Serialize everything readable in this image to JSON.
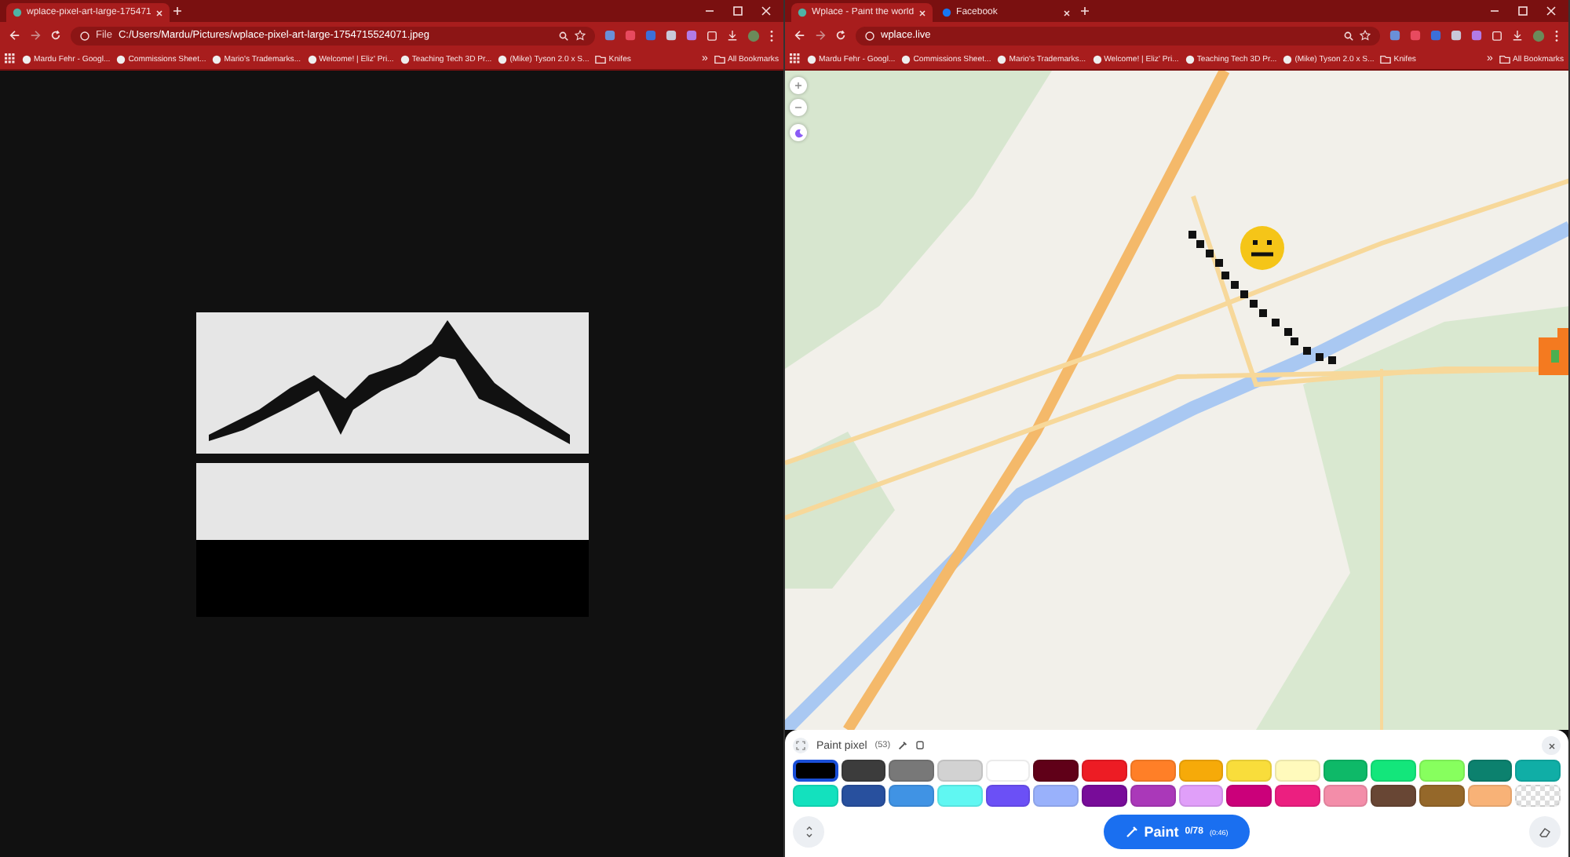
{
  "windows": [
    {
      "kind": "viewer",
      "tabs": [
        {
          "title": "wplace-pixel-art-large-175471",
          "selected": true
        }
      ],
      "address": {
        "scheme": "File",
        "url": "C:/Users/Mardu/Pictures/wplace-pixel-art-large-1754715524071.jpeg"
      },
      "bookmarks": [
        {
          "kind": "site",
          "label": "Mardu Fehr - Googl..."
        },
        {
          "kind": "site",
          "label": "Commissions Sheet..."
        },
        {
          "kind": "site",
          "label": "Mario's Trademarks..."
        },
        {
          "kind": "site",
          "label": "Welcome! | Eliz' Pri..."
        },
        {
          "kind": "site",
          "label": "Teaching Tech 3D Pr..."
        },
        {
          "kind": "site",
          "label": "(Mike) Tyson 2.0 x S..."
        },
        {
          "kind": "folder",
          "label": "Knifes"
        }
      ],
      "more": "»",
      "all_bookmarks": "All Bookmarks"
    },
    {
      "kind": "map",
      "tabs": [
        {
          "title": "Wplace - Paint the world",
          "selected": true
        },
        {
          "title": "Facebook",
          "selected": false
        }
      ],
      "address": {
        "url": "wplace.live"
      },
      "bookmarks": [
        {
          "kind": "site",
          "label": "Mardu Fehr - Googl..."
        },
        {
          "kind": "site",
          "label": "Commissions Sheet..."
        },
        {
          "kind": "site",
          "label": "Mario's Trademarks..."
        },
        {
          "kind": "site",
          "label": "Welcome! | Eliz' Pri..."
        },
        {
          "kind": "site",
          "label": "Teaching Tech 3D Pr..."
        },
        {
          "kind": "site",
          "label": "(Mike) Tyson 2.0 x S..."
        },
        {
          "kind": "folder",
          "label": "Knifes"
        }
      ],
      "more": "»",
      "all_bookmarks": "All Bookmarks",
      "panel": {
        "title": "Paint pixel",
        "count": "(53)",
        "paint_label": "Paint",
        "progress": "0/78",
        "timer": "(0:46)",
        "colors": [
          {
            "kind": "color",
            "color": "#000000",
            "selected": true
          },
          {
            "kind": "color",
            "color": "#3c3c3c",
            "selected": false
          },
          {
            "kind": "color",
            "color": "#787878",
            "selected": false
          },
          {
            "kind": "color",
            "color": "#d2d2d2",
            "selected": false
          },
          {
            "kind": "color",
            "color": "#ffffff",
            "selected": false
          },
          {
            "kind": "color",
            "color": "#600018",
            "selected": false
          },
          {
            "kind": "color",
            "color": "#ed1c24",
            "selected": false
          },
          {
            "kind": "color",
            "color": "#ff7f27",
            "selected": false
          },
          {
            "kind": "color",
            "color": "#f6aa09",
            "selected": false
          },
          {
            "kind": "color",
            "color": "#f9dd3b",
            "selected": false
          },
          {
            "kind": "color",
            "color": "#fffabc",
            "selected": false
          },
          {
            "kind": "color",
            "color": "#0eb968",
            "selected": false
          },
          {
            "kind": "color",
            "color": "#13e67b",
            "selected": false
          },
          {
            "kind": "color",
            "color": "#87ff5e",
            "selected": false
          },
          {
            "kind": "color",
            "color": "#0c816e",
            "selected": false
          },
          {
            "kind": "color",
            "color": "#10aea6",
            "selected": false
          },
          {
            "kind": "color",
            "color": "#13e1be",
            "selected": false
          },
          {
            "kind": "color",
            "color": "#28509e",
            "selected": false
          },
          {
            "kind": "color",
            "color": "#4093e4",
            "selected": false
          },
          {
            "kind": "color",
            "color": "#60f7f2",
            "selected": false
          },
          {
            "kind": "color",
            "color": "#6b50f6",
            "selected": false
          },
          {
            "kind": "color",
            "color": "#99b1fb",
            "selected": false
          },
          {
            "kind": "color",
            "color": "#780c99",
            "selected": false
          },
          {
            "kind": "color",
            "color": "#aa38b9",
            "selected": false
          },
          {
            "kind": "color",
            "color": "#e09ff9",
            "selected": false
          },
          {
            "kind": "color",
            "color": "#cb007a",
            "selected": false
          },
          {
            "kind": "color",
            "color": "#ec1f80",
            "selected": false
          },
          {
            "kind": "color",
            "color": "#f38da9",
            "selected": false
          },
          {
            "kind": "color",
            "color": "#684634",
            "selected": false
          },
          {
            "kind": "color",
            "color": "#95682a",
            "selected": false
          },
          {
            "kind": "color",
            "color": "#f8b277",
            "selected": false
          },
          {
            "kind": "transparent",
            "selected": false
          }
        ]
      }
    }
  ]
}
